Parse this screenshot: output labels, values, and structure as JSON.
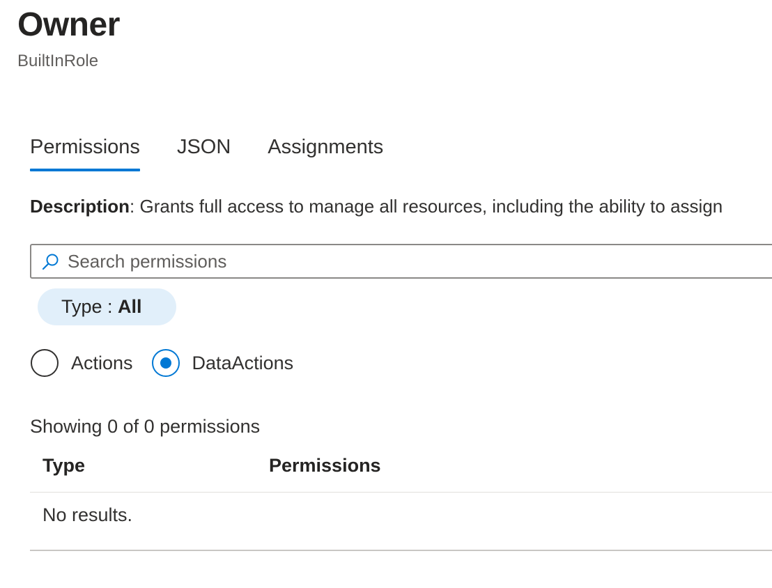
{
  "header": {
    "title": "Owner",
    "subtitle": "BuiltInRole"
  },
  "tabs": [
    {
      "label": "Permissions",
      "active": true
    },
    {
      "label": "JSON",
      "active": false
    },
    {
      "label": "Assignments",
      "active": false
    }
  ],
  "description": {
    "label": "Description",
    "text": ": Grants full access to manage all resources, including the ability to assign"
  },
  "search": {
    "placeholder": "Search permissions",
    "value": "",
    "icon": "search-icon"
  },
  "filter": {
    "label": "Type : ",
    "value": "All"
  },
  "radios": [
    {
      "label": "Actions",
      "checked": false
    },
    {
      "label": "DataActions",
      "checked": true
    }
  ],
  "results": {
    "summary": "Showing 0 of 0 permissions",
    "columns": [
      "Type",
      "Permissions"
    ],
    "empty_text": "No results."
  },
  "colors": {
    "accent": "#0078d4",
    "pill_background": "#e1effa",
    "text": "#323130"
  }
}
